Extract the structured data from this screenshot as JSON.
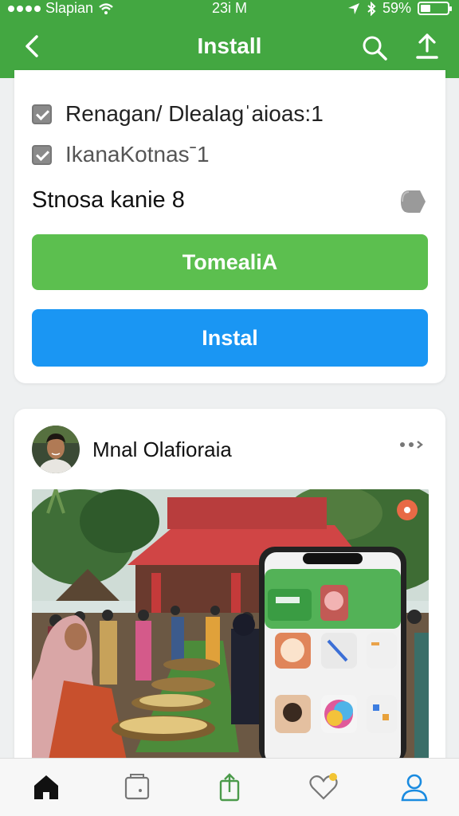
{
  "status": {
    "carrier": "Slapian",
    "time": "23i M",
    "battery": "59%"
  },
  "appbar": {
    "title": "Install"
  },
  "options": [
    {
      "label": "Renagan/ Dlealagˈaioas:1",
      "checked": true
    },
    {
      "label": "IkanaKotnasˉ1",
      "checked": true
    }
  ],
  "setting": {
    "label": "Stnosa kanie 8"
  },
  "buttons": {
    "primary": "TomealiA",
    "install": "Instal"
  },
  "post": {
    "author": "Mnal Olafioraia"
  },
  "colors": {
    "brand_green": "#43a741",
    "button_green": "#5cbf4f",
    "button_blue": "#1a96f3",
    "active_tab": "#1a8be0"
  },
  "nav": [
    {
      "icon": "home-icon",
      "active": false
    },
    {
      "icon": "book-icon",
      "active": false
    },
    {
      "icon": "share-icon",
      "active": false
    },
    {
      "icon": "heart-icon",
      "active": false
    },
    {
      "icon": "profile-icon",
      "active": true
    }
  ]
}
